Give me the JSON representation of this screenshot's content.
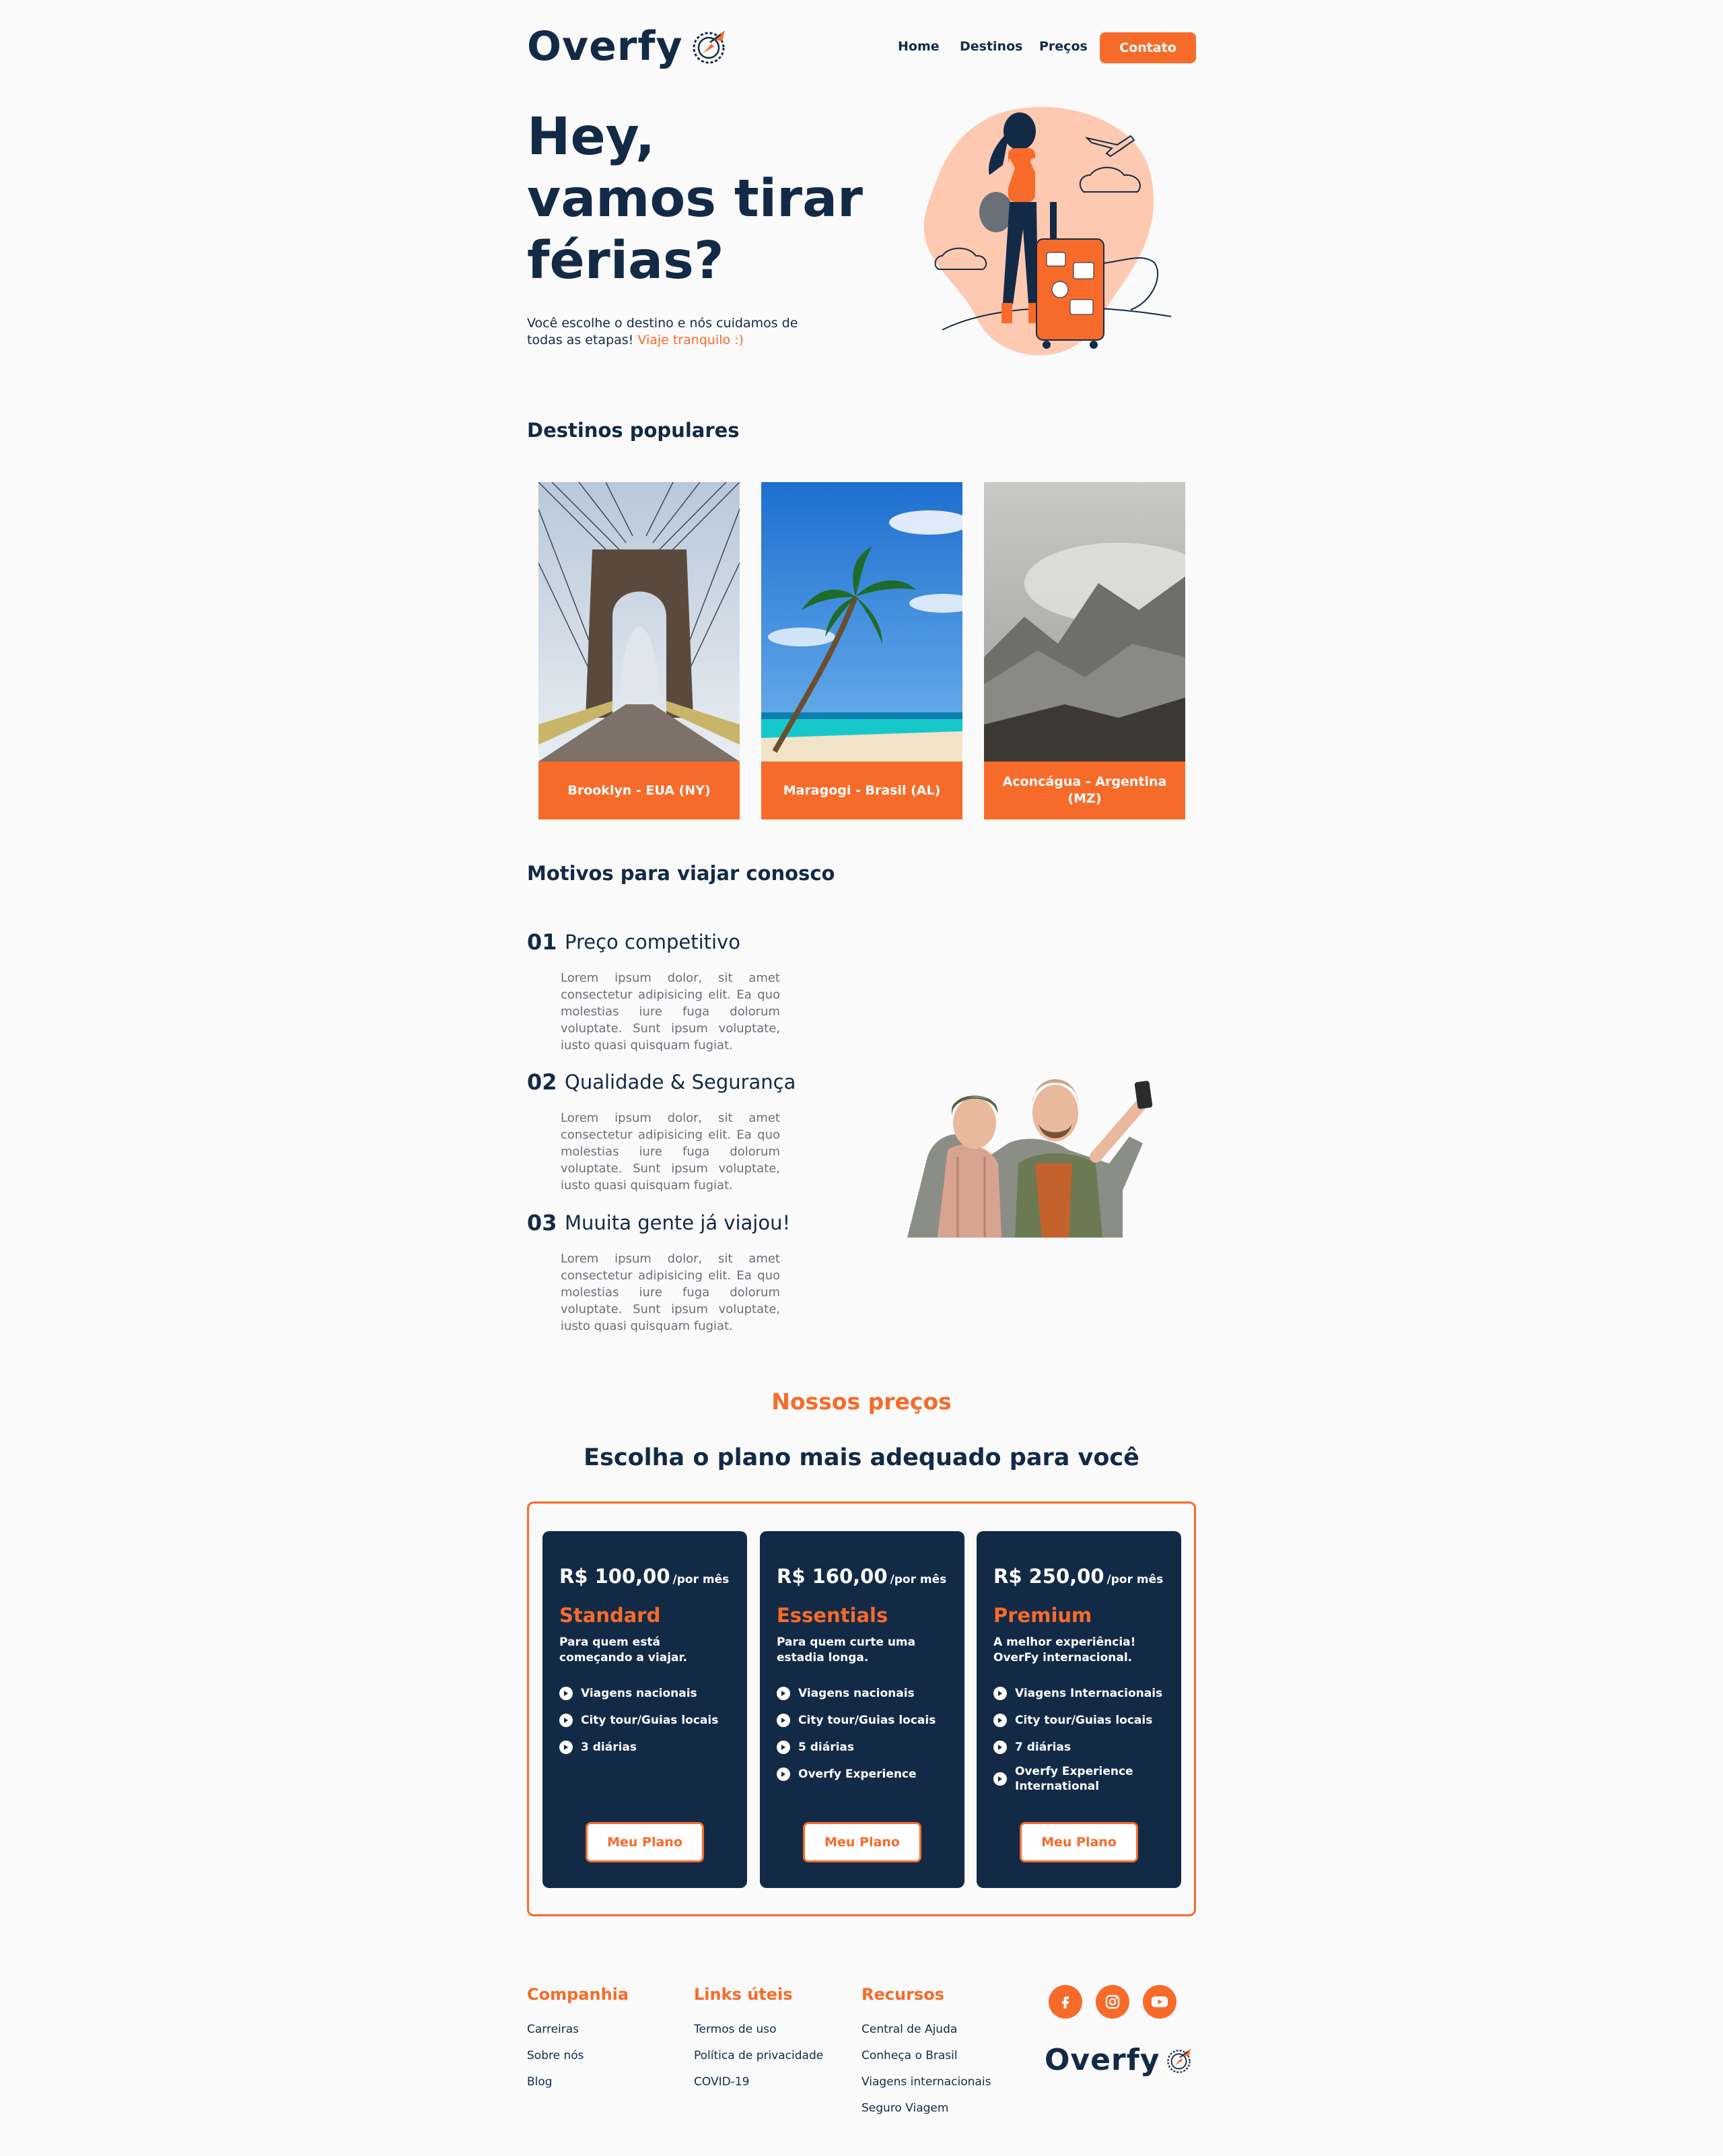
{
  "brand": {
    "logo_text": "Overfy",
    "accent_color": "#f76b2a",
    "navy_color": "#132a47",
    "logo_icon": "compass-plane-icon"
  },
  "nav": {
    "items": [
      {
        "label": "Home"
      },
      {
        "label": "Destinos"
      },
      {
        "label": "Preços"
      }
    ],
    "cta_label": "Contato"
  },
  "hero": {
    "title_lines": [
      "Hey,",
      "vamos tirar",
      "férias?"
    ],
    "subtitle": "Você escolhe o destino e nós cuidamos de todas as etapas!",
    "subtitle_accent": "Viaje tranquilo :)",
    "illustration": "traveler-with-suitcase-illustration"
  },
  "destinations": {
    "title": "Destinos populares",
    "items": [
      {
        "label": "Brooklyn - EUA (NY)",
        "photo": "brooklyn-bridge-photo"
      },
      {
        "label": "Maragogi - Brasil (AL)",
        "photo": "beach-palm-tree-photo"
      },
      {
        "label": "Aconcágua - Argentina (MZ)",
        "photo": "mountain-photo"
      }
    ]
  },
  "reasons": {
    "title": "Motivos para viajar conosco",
    "items": [
      {
        "num": "01",
        "title": "Preço competitivo",
        "text": "Lorem ipsum dolor, sit amet consectetur adipisicing elit. Ea quo molestias iure fuga dolorum voluptate. Sunt ipsum voluptate, iusto quasi quisquam fugiat."
      },
      {
        "num": "02",
        "title": "Qualidade & Segurança",
        "text": "Lorem ipsum dolor, sit amet consectetur adipisicing elit. Ea quo molestias iure fuga dolorum voluptate. Sunt ipsum voluptate, iusto quasi quisquam fugiat."
      },
      {
        "num": "03",
        "title": "Muuita gente já viajou!",
        "text": "Lorem ipsum dolor, sit amet consectetur adipisicing elit. Ea quo molestias iure fuga dolorum voluptate. Sunt ipsum voluptate, iusto quasi quisquam fugiat."
      }
    ],
    "photo": "couple-selfie-photo"
  },
  "pricing": {
    "kicker": "Nossos preços",
    "title": "Escolha o plano mais adequado para você",
    "plans": [
      {
        "price": "R$ 100,00",
        "per": "/por mês",
        "name": "Standard",
        "desc": "Para quem está começando a viajar.",
        "features": [
          "Viagens nacionais",
          "City tour/Guias locais",
          "3 diárias"
        ],
        "button": "Meu Plano"
      },
      {
        "price": "R$ 160,00",
        "per": "/por mês",
        "name": "Essentials",
        "desc": "Para quem curte uma estadia longa.",
        "features": [
          "Viagens nacionais",
          "City tour/Guias locais",
          "5 diárias",
          "Overfy Experience"
        ],
        "button": "Meu Plano"
      },
      {
        "price": "R$ 250,00",
        "per": "/por mês",
        "name": "Premium",
        "desc": "A melhor experiência! OverFy internacional.",
        "features": [
          "Viagens Internacionais",
          "City tour/Guias locais",
          "7 diárias",
          "Overfy Experience International"
        ],
        "button": "Meu Plano"
      }
    ]
  },
  "footer": {
    "columns": [
      {
        "title": "Companhia",
        "links": [
          "Carreiras",
          "Sobre nós",
          "Blog"
        ]
      },
      {
        "title": "Links úteis",
        "links": [
          "Termos de uso",
          "Política de privacidade",
          "COVID-19"
        ]
      },
      {
        "title": "Recursos",
        "links": [
          "Central de Ajuda",
          "Conheça o Brasil",
          "Viagens internacionais",
          "Seguro Viagem"
        ]
      }
    ],
    "social": [
      "facebook-icon",
      "instagram-icon",
      "youtube-icon"
    ],
    "logo_text": "Overfy"
  }
}
